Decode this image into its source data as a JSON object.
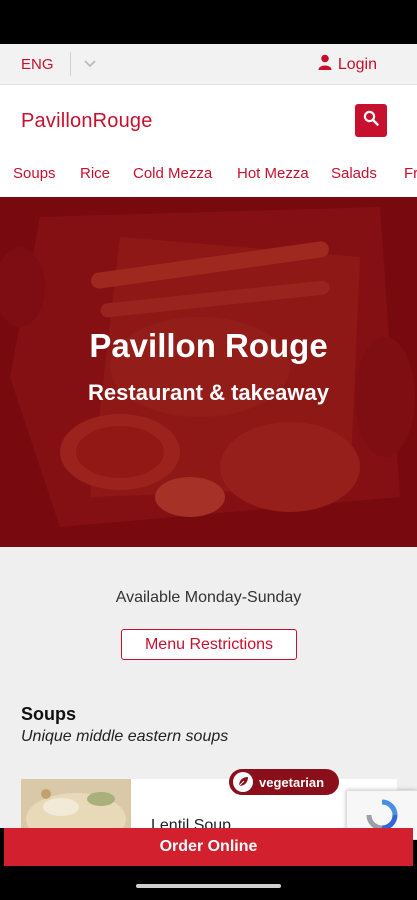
{
  "topbar": {
    "language": "ENG",
    "login_label": "Login"
  },
  "header": {
    "brand": "PavillonRouge"
  },
  "categories": [
    "Soups",
    "Rice",
    "Cold Mezza",
    "Hot Mezza",
    "Salads",
    "Fr"
  ],
  "hero": {
    "title": "Pavillon Rouge",
    "subtitle": "Restaurant & takeaway"
  },
  "content": {
    "availability": "Available Monday-Sunday",
    "restrictions_button": "Menu Restrictions",
    "section_title": "Soups",
    "section_subtitle": "Unique middle eastern soups",
    "item": {
      "name": "Lentil Soup",
      "badge": "vegetarian"
    }
  },
  "footer": {
    "order_button": "Order Online"
  },
  "colors": {
    "accent": "#c8102e",
    "order_bar": "#d3202f",
    "badge": "#8b0f1a"
  },
  "icons": {
    "language_dropdown": "chevron-down-icon",
    "login": "user-icon",
    "search": "search-icon",
    "badge": "leaf-icon",
    "recaptcha": "recaptcha-icon"
  }
}
